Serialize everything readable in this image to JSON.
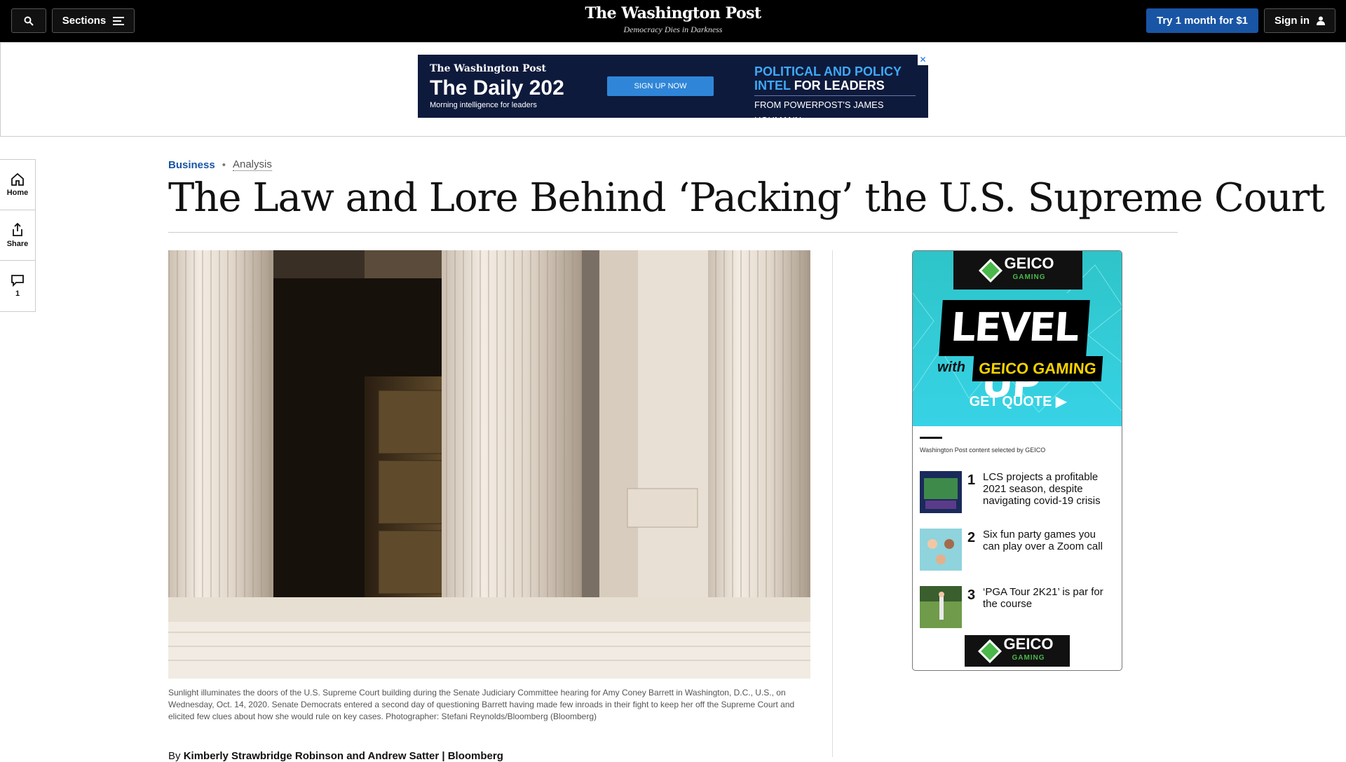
{
  "topbar": {
    "sections_label": "Sections",
    "try_label": "Try 1 month for $1",
    "signin_label": "Sign in",
    "masthead": "The Washington Post",
    "tagline": "Democracy Dies in Darkness",
    "bg_color": "#000000",
    "try_color": "#1955a5"
  },
  "banner_ad": {
    "brand": "The Washington Post",
    "title": "The Daily 202",
    "subtitle": "Morning intelligence for leaders",
    "cta": "SIGN UP NOW",
    "headline_blue": "POLITICAL AND POLICY INTEL",
    "headline_white": "FOR LEADERS",
    "from": "FROM POWERPOST'S JAMES HOHMANN",
    "close": "✕"
  },
  "siderail": {
    "home": "Home",
    "share": "Share",
    "comments_count": "1"
  },
  "article": {
    "section": "Business",
    "label": "Analysis",
    "headline": "The Law and Lore Behind ‘Packing’ the U.S. Supreme Court",
    "caption": "Sunlight illuminates the doors of the U.S. Supreme Court building during the Senate Judiciary Committee hearing for Amy Coney Barrett in Washington, D.C., U.S., on Wednesday, Oct. 14, 2020. Senate Democrats entered a second day of questioning Barrett having made few inroads in their fight to keep her off the Supreme Court and elicited few clues about how she would rule on key cases. Photographer: Stefani Reynolds/Bloomberg (Bloomberg)",
    "byline_prefix": "By",
    "byline_authors": "Kimberly Strawbridge Robinson and Andrew Satter | Bloomberg",
    "accent_color": "#1955a5"
  },
  "sponsor": {
    "geico": "GEICO",
    "gaming": "GAMING",
    "level_up": "LEVEL UP",
    "with": "with",
    "geico_gaming": "GEICO GAMING",
    "get_quote": "GET QUOTE ▶",
    "note": "Washington Post content selected by GEICO",
    "items": [
      {
        "num": "1",
        "title": "LCS projects a profitable 2021 season, despite navigating covid-19 crisis"
      },
      {
        "num": "2",
        "title": "Six fun party games you can play over a Zoom call"
      },
      {
        "num": "3",
        "title": "‘PGA Tour 2K21’ is par for the course"
      }
    ]
  }
}
